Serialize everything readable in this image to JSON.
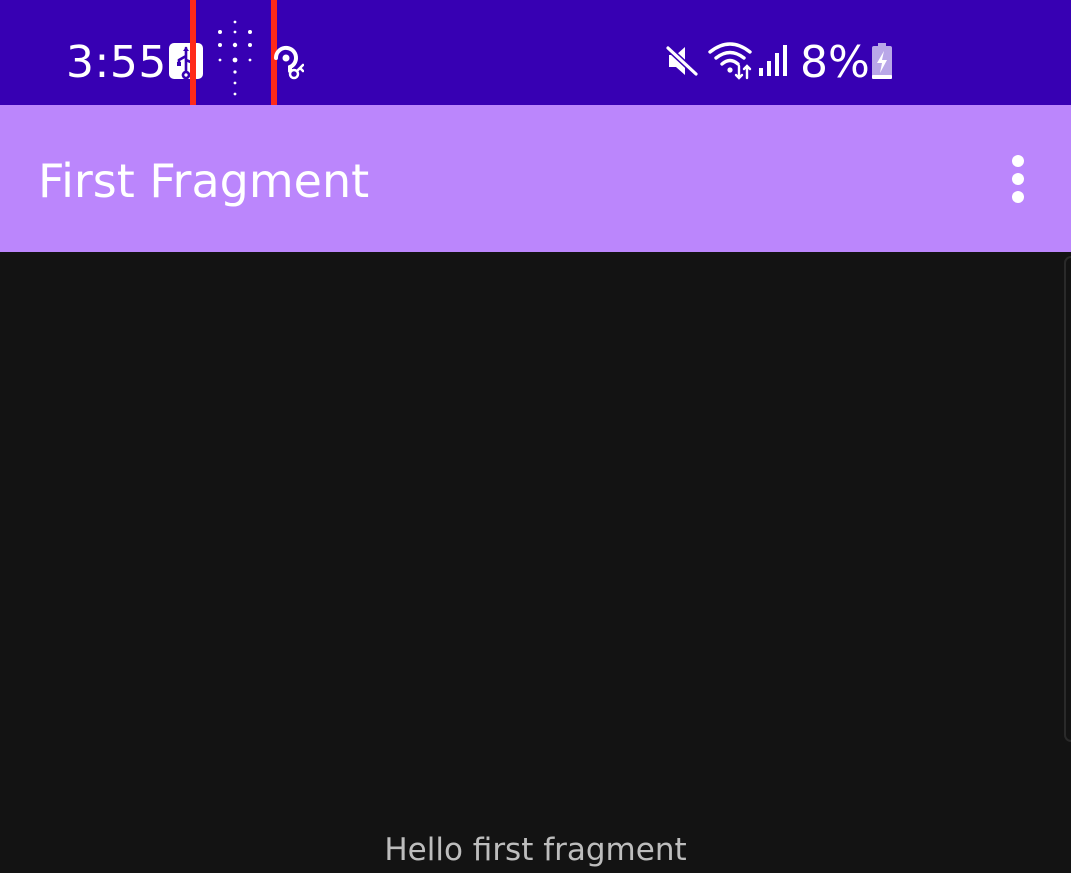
{
  "status_bar": {
    "time": "3:55",
    "battery_percent": "8%",
    "background_color": "#3700b3",
    "icons": [
      "usb-icon",
      "dots-grid-icon",
      "vpn-key-icon",
      "mute-icon",
      "wifi-icon",
      "signal-icon",
      "battery-charging-icon"
    ],
    "highlight_color": "#ff2a1a"
  },
  "app_bar": {
    "title": "First Fragment",
    "background_color": "#bb86fc",
    "menu_icon": "more-vert-icon"
  },
  "content": {
    "message": "Hello first fragment",
    "background_color": "#131313"
  }
}
